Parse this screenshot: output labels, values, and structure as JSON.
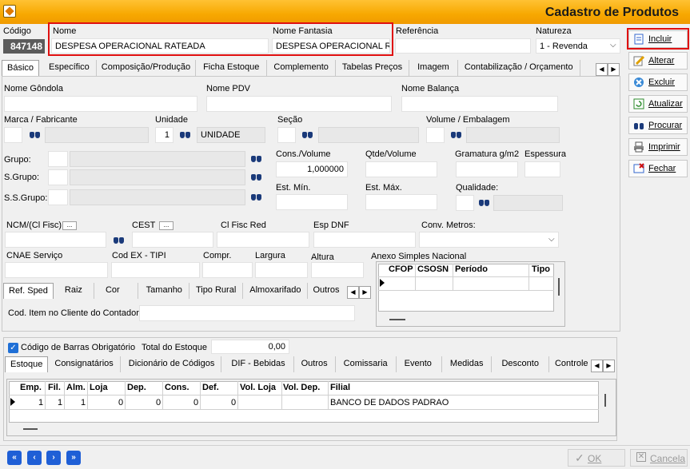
{
  "window": {
    "title": "Cadastro de Produtos"
  },
  "header": {
    "codigo_label": "Código",
    "codigo_value": "847148",
    "nome_label": "Nome",
    "nome_value": "DESPESA OPERACIONAL RATEADA",
    "fantasia_label": "Nome Fantasia",
    "fantasia_value": "DESPESA OPERACIONAL R.",
    "referencia_label": "Referência",
    "referencia_value": "",
    "natureza_label": "Natureza",
    "natureza_value": "1 - Revenda"
  },
  "tabs": [
    "Básico",
    "Específico",
    "Composição/Produção",
    "Ficha Estoque",
    "Complemento",
    "Tabelas Preços",
    "Imagem",
    "Contabilização / Orçamento"
  ],
  "side_buttons": [
    "Incluir",
    "Alterar",
    "Excluir",
    "Atualizar",
    "Procurar",
    "Imprimir",
    "Fechar"
  ],
  "basico": {
    "gondola": "Nome Gôndola",
    "pdv": "Nome PDV",
    "balanca": "Nome Balança",
    "marca": "Marca / Fabricante",
    "unidade": "Unidade",
    "unidade_code": "1",
    "unidade_desc": "UNIDADE",
    "secao": "Seção",
    "volume": "Volume / Embalagem",
    "grupo": "Grupo:",
    "sgrupo": "S.Grupo:",
    "ssgrupo": "S.S.Grupo:",
    "cons_volume": "Cons./Volume",
    "cons_volume_value": "1,000000",
    "qtde_volume": "Qtde/Volume",
    "gramatura": "Gramatura g/m2",
    "espessura": "Espessura",
    "est_min": "Est. Mín.",
    "est_max": "Est. Máx.",
    "qualidade": "Qualidade:",
    "ncm": "NCM/(Cl Fisc)",
    "cest": "CEST",
    "cl_fisc_red": "Cl Fisc Red",
    "esp_dnf": "Esp DNF",
    "conv_metros": "Conv. Metros:",
    "cnae": "CNAE Serviço",
    "cod_ex": "Cod EX - TIPI",
    "compr": "Compr.",
    "largura": "Largura",
    "altura": "Altura",
    "anexo": "Anexo Simples Nacional",
    "anexo_cols": [
      "CFOP",
      "CSOSN",
      "Período",
      "Tipo"
    ],
    "dots": "..."
  },
  "subtabs": [
    "Ref. Sped",
    "Raiz",
    "Cor",
    "Tamanho",
    "Tipo Rural",
    "Almoxarifado",
    "Outros"
  ],
  "cod_item_label": "Cod. Item no Cliente do Contador:",
  "stock": {
    "barras_label": "Código de Barras Obrigatório",
    "total_label": "Total do Estoque",
    "total_value": "0,00",
    "tabs": [
      "Estoque",
      "Consignatários",
      "Dicionário de Códigos",
      "DIF - Bebidas",
      "Outros",
      "Comissaria",
      "Evento",
      "Medidas",
      "Desconto",
      "Controle d"
    ],
    "cols": [
      "Emp.",
      "Fil.",
      "Alm.",
      "Loja",
      "Dep.",
      "Cons.",
      "Def.",
      "Vol. Loja",
      "Vol. Dep.",
      "Filial"
    ],
    "row": [
      "1",
      "1",
      "1",
      "0",
      "0",
      "0",
      "0",
      "",
      "",
      "BANCO DE DADOS PADRAO"
    ]
  },
  "footer": {
    "ok": "OK",
    "cancel": "Cancela"
  }
}
